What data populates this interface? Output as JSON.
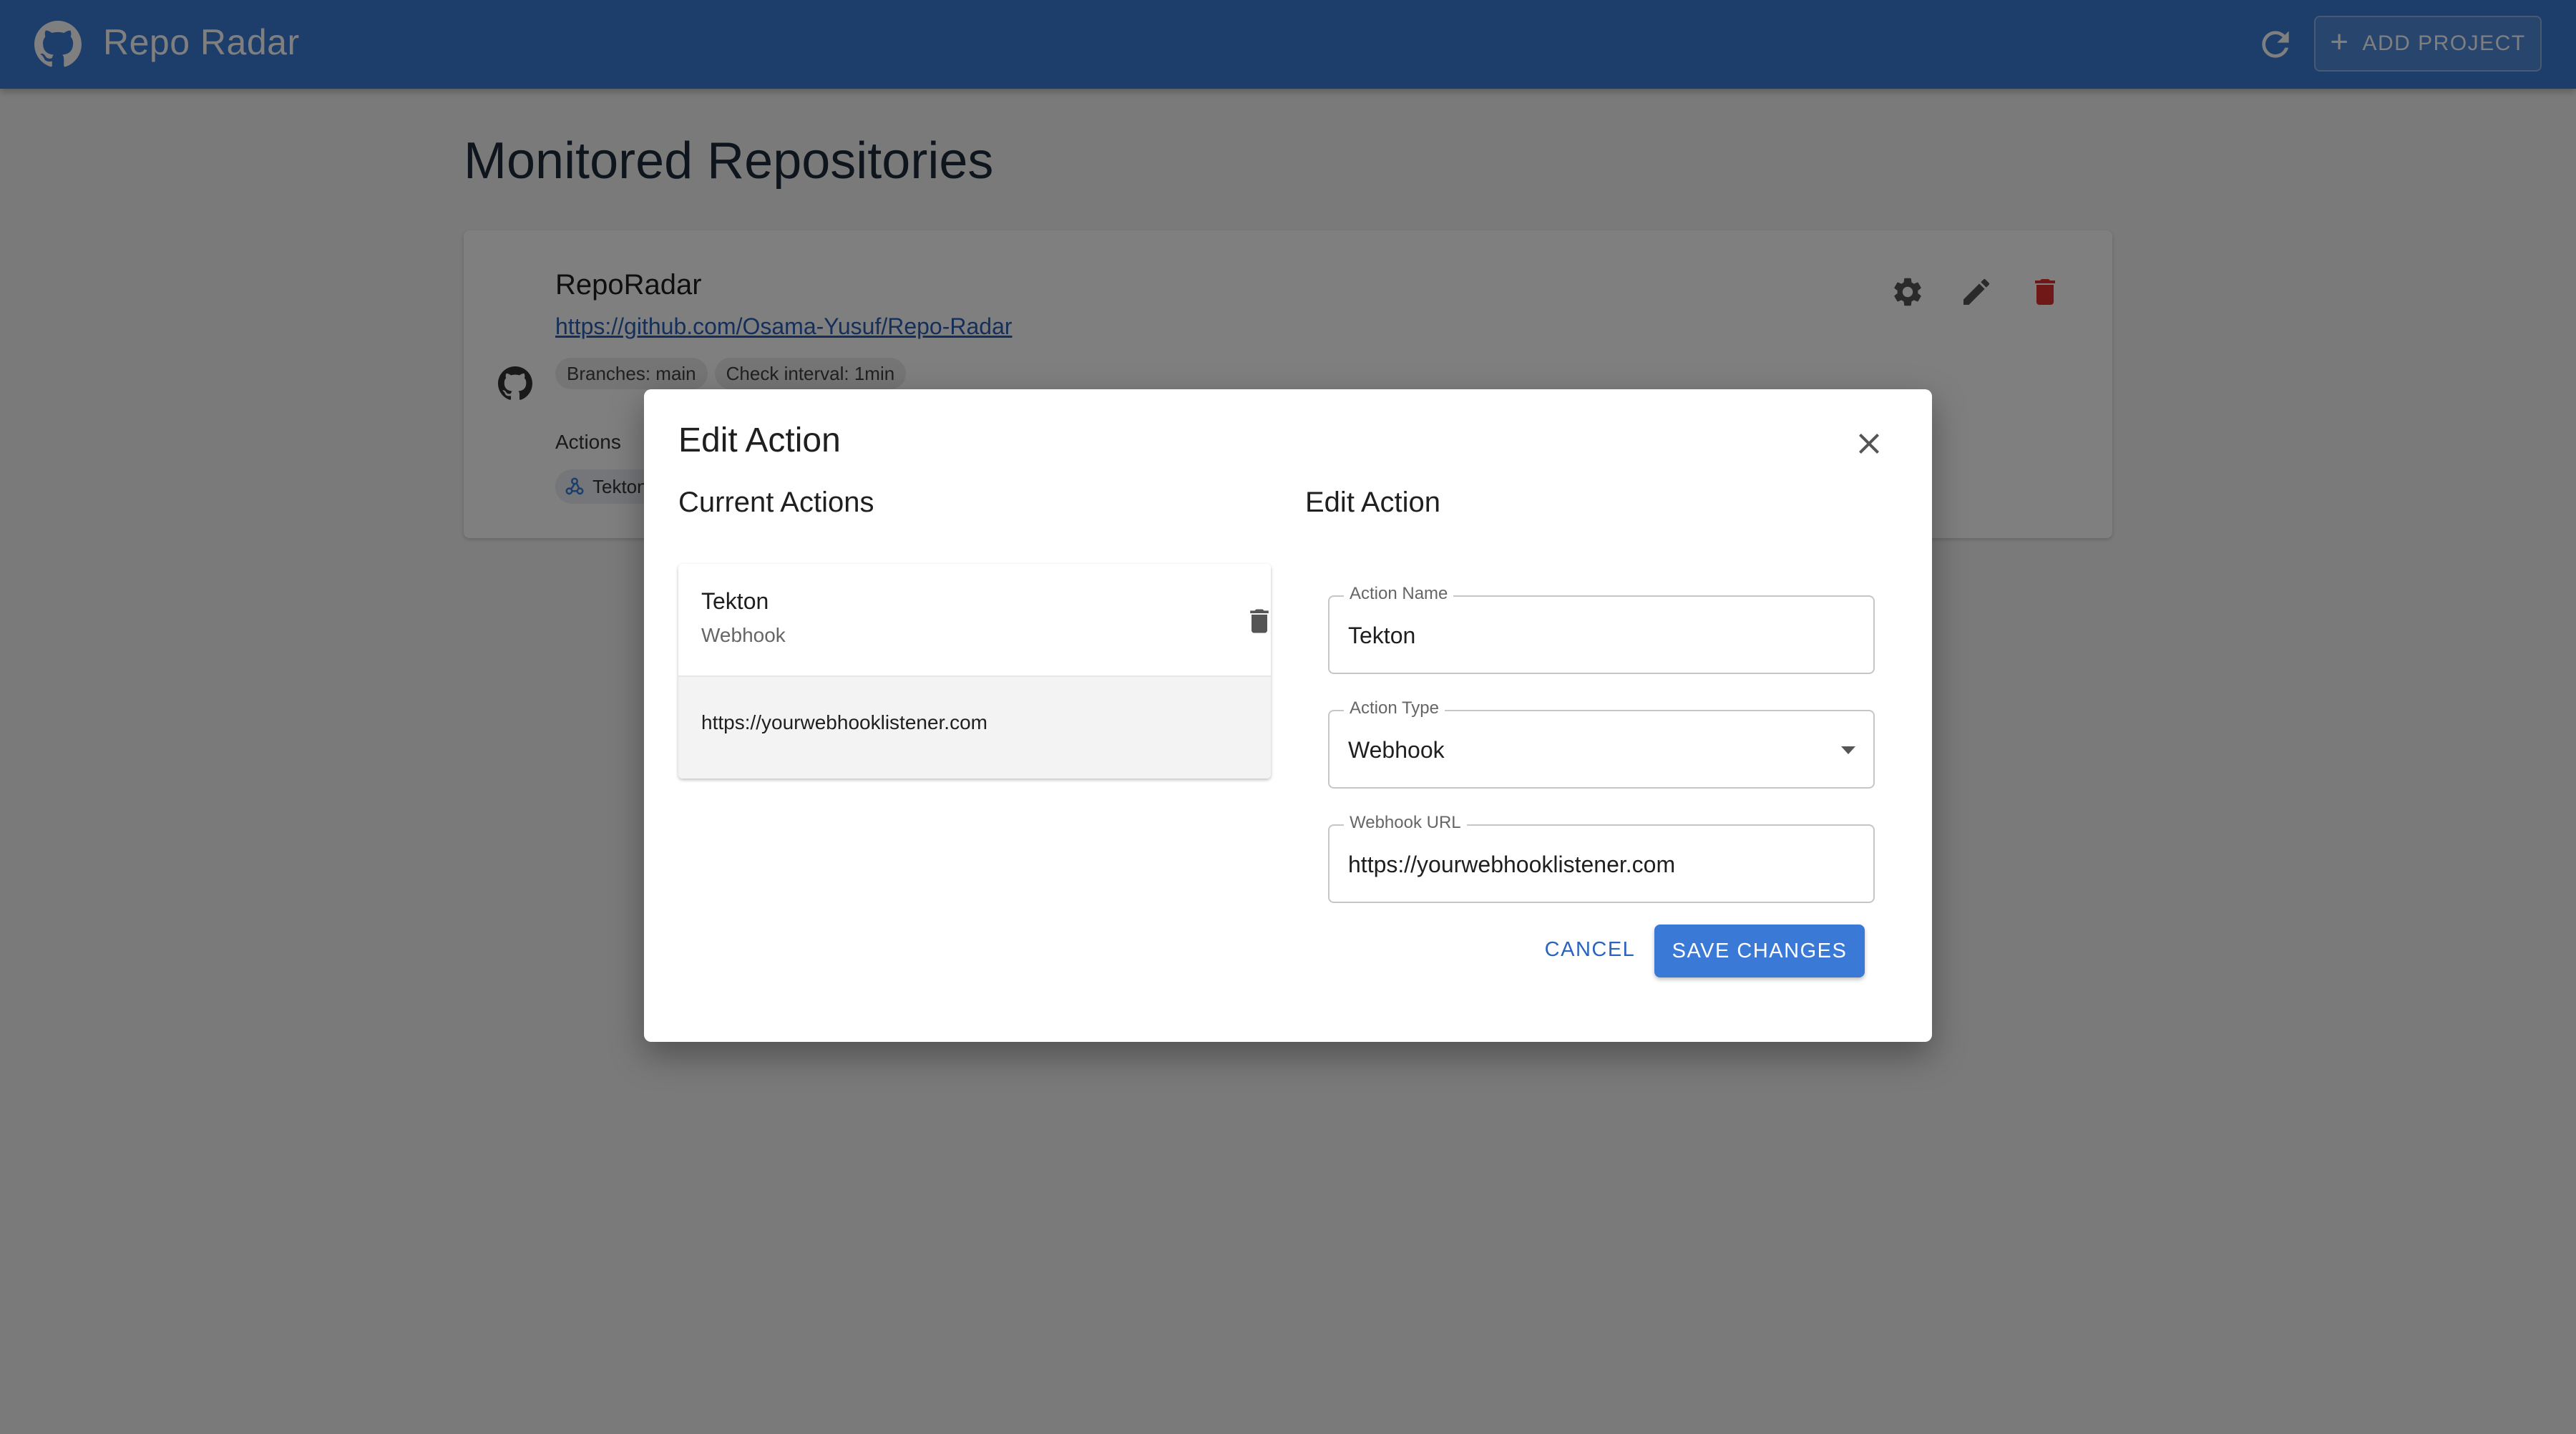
{
  "appbar": {
    "title": "Repo Radar",
    "add_project_label": "ADD PROJECT"
  },
  "page": {
    "title": "Monitored Repositories"
  },
  "repo": {
    "name": "RepoRadar",
    "url": "https://github.com/Osama-Yusuf/Repo-Radar",
    "chips": [
      "Branches: main",
      "Check interval: 1min"
    ],
    "actions_label": "Actions",
    "action_chip": "Tekton"
  },
  "dialog": {
    "title": "Edit Action",
    "current_actions_title": "Current Actions",
    "edit_action_title": "Edit Action",
    "current_action": {
      "name": "Tekton",
      "type": "Webhook",
      "url": "https://yourwebhooklistener.com"
    },
    "fields": {
      "action_name": {
        "label": "Action Name",
        "value": "Tekton"
      },
      "action_type": {
        "label": "Action Type",
        "value": "Webhook"
      },
      "webhook_url": {
        "label": "Webhook URL",
        "value": "https://yourwebhooklistener.com"
      }
    },
    "cancel_label": "CANCEL",
    "save_label": "SAVE CHANGES"
  },
  "colors": {
    "primary": "#3a7ad6",
    "link": "#2a5fb7",
    "danger": "#e0312e"
  },
  "icons": [
    "github-icon",
    "refresh-icon",
    "plus-icon",
    "gear-icon",
    "pencil-icon",
    "trash-icon",
    "webhook-icon",
    "close-icon",
    "caret-down-icon"
  ]
}
